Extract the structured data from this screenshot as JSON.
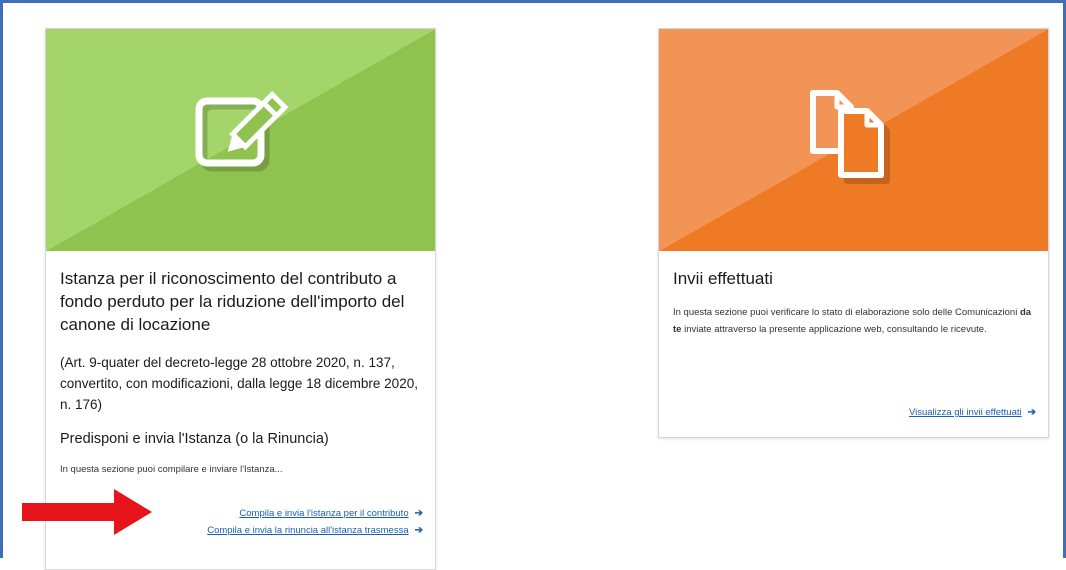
{
  "colors": {
    "frame": "#3f6fb6",
    "green_light": "#a3d56b",
    "green_dark": "#8fc24f",
    "orange_light": "#f29456",
    "orange_dark": "#ef7a26",
    "link": "#1a5fb4",
    "red_arrow": "#e8141c"
  },
  "card_istanza": {
    "icon": "edit-document-icon",
    "title": "Istanza per il riconoscimento del contributo a fondo perduto per la riduzione dell'importo del canone di locazione",
    "subtitle": "(Art. 9-quater del decreto-legge 28 ottobre 2020, n. 137, convertito, con modificazioni, dalla legge 18 dicembre 2020, n. 176)",
    "section_title": "Predisponi e invia l'Istanza (o la Rinuncia)",
    "description": "In questa sezione puoi compilare e inviare l'Istanza...",
    "links": [
      {
        "label": "Compila e invia l'istanza per il contributo"
      },
      {
        "label": "Compila e invia la rinuncia all'istanza trasmessa"
      }
    ]
  },
  "card_invii": {
    "icon": "documents-copy-icon",
    "title": "Invii effettuati",
    "description_before": "In questa sezione puoi verificare lo stato di elaborazione solo delle Comunicazioni ",
    "description_bold": "da te",
    "description_after": " inviate attraverso la presente applicazione web, consultando le ricevute.",
    "link": {
      "label": "Visualizza gli invii effettuati"
    }
  },
  "annotation": {
    "icon": "red-arrow-icon"
  }
}
